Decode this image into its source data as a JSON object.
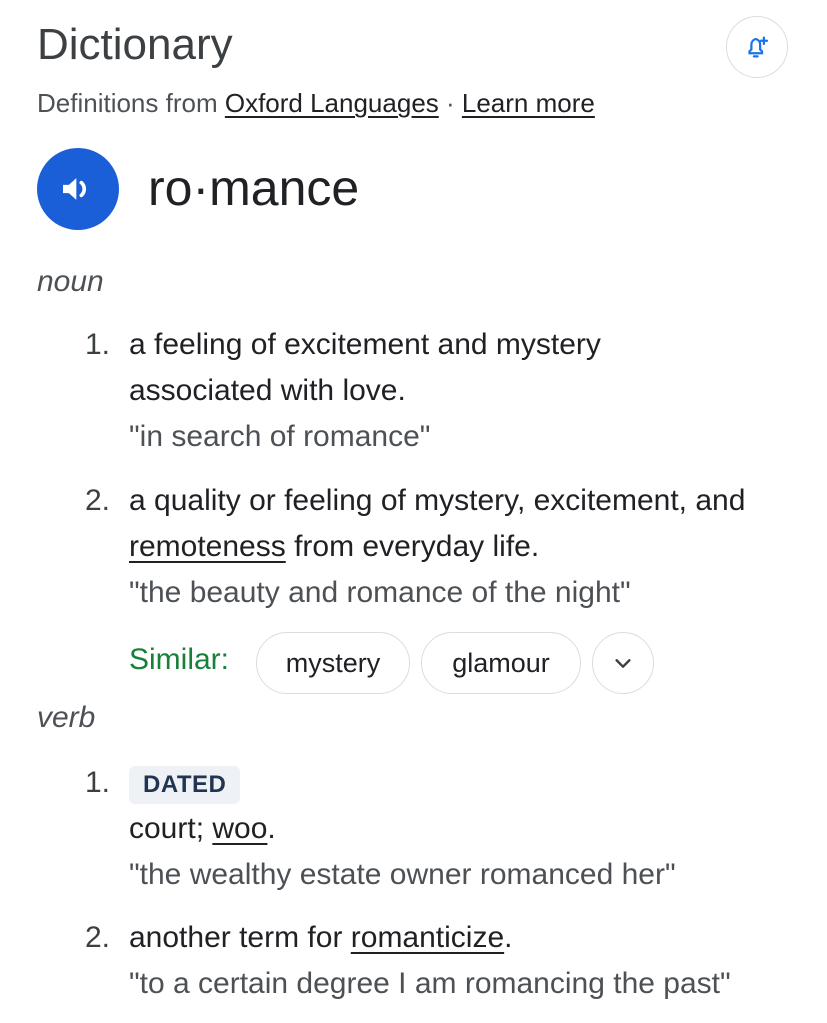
{
  "header": {
    "title": "Dictionary",
    "source_prefix": "Definitions from ",
    "source_link": "Oxford Languages",
    "separator": " · ",
    "learn_more": "Learn more"
  },
  "entry": {
    "headword": "ro·mance"
  },
  "noun": {
    "pos": "noun",
    "senses": [
      {
        "num": "1.",
        "def_line1": "a feeling of excitement and mystery",
        "def_line2": "associated with love.",
        "example": "\"in search of romance\""
      },
      {
        "num": "2.",
        "def_line1": "a quality or feeling of mystery, excitement, and",
        "def_line2_link": "remoteness",
        "def_line2_rest": " from everyday life.",
        "example": "\"the beauty and romance of the night\""
      }
    ],
    "similar_label": "Similar:",
    "similar_chips": [
      "mystery",
      "glamour"
    ]
  },
  "verb": {
    "pos": "verb",
    "senses": [
      {
        "num": "1.",
        "label": "DATED",
        "def_prefix": "court; ",
        "def_link": "woo",
        "def_suffix": ".",
        "example": "\"the wealthy estate owner romanced her\""
      },
      {
        "num": "2.",
        "def_prefix": "another term for ",
        "def_link": "romanticize",
        "def_suffix": ".",
        "example": "\"to a certain degree I am romancing the past\""
      }
    ]
  },
  "icons": {
    "alert": "bell-plus-icon",
    "speaker": "speaker-icon",
    "expand": "chevron-down-icon"
  },
  "colors": {
    "speaker_bg": "#1a5ed8",
    "similar_label": "#188038"
  }
}
